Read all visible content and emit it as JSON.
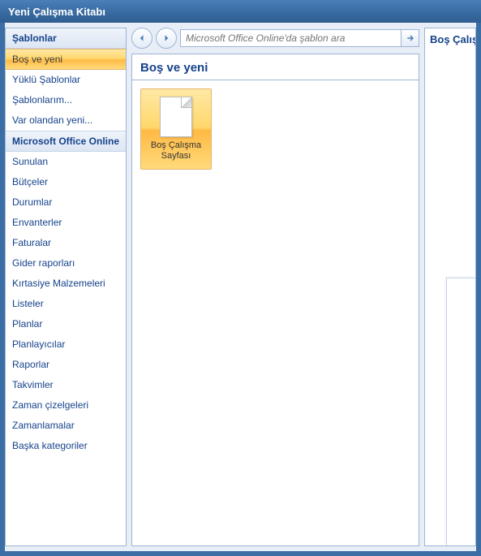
{
  "window": {
    "title": "Yeni Çalışma Kitabı"
  },
  "sidebar": {
    "header": "Şablonlar",
    "items_top": [
      {
        "label": "Boş ve yeni",
        "selected": true
      },
      {
        "label": "Yüklü Şablonlar",
        "selected": false
      },
      {
        "label": "Şablonlarım...",
        "selected": false
      },
      {
        "label": "Var olandan yeni...",
        "selected": false
      }
    ],
    "section": "Microsoft Office Online",
    "items_online": [
      {
        "label": "Sunulan"
      },
      {
        "label": "Bütçeler"
      },
      {
        "label": "Durumlar"
      },
      {
        "label": "Envanterler"
      },
      {
        "label": "Faturalar"
      },
      {
        "label": "Gider raporları"
      },
      {
        "label": "Kırtasiye Malzemeleri"
      },
      {
        "label": "Listeler"
      },
      {
        "label": "Planlar"
      },
      {
        "label": "Planlayıcılar"
      },
      {
        "label": "Raporlar"
      },
      {
        "label": "Takvimler"
      },
      {
        "label": "Zaman çizelgeleri"
      },
      {
        "label": "Zamanlamalar"
      },
      {
        "label": "Başka kategoriler"
      }
    ]
  },
  "search": {
    "placeholder": "Microsoft Office Online'da şablon ara"
  },
  "content": {
    "header": "Boş ve yeni",
    "templates": [
      {
        "label": "Boş Çalışma Sayfası",
        "selected": true
      }
    ]
  },
  "preview": {
    "header": "Boş Çalış"
  }
}
